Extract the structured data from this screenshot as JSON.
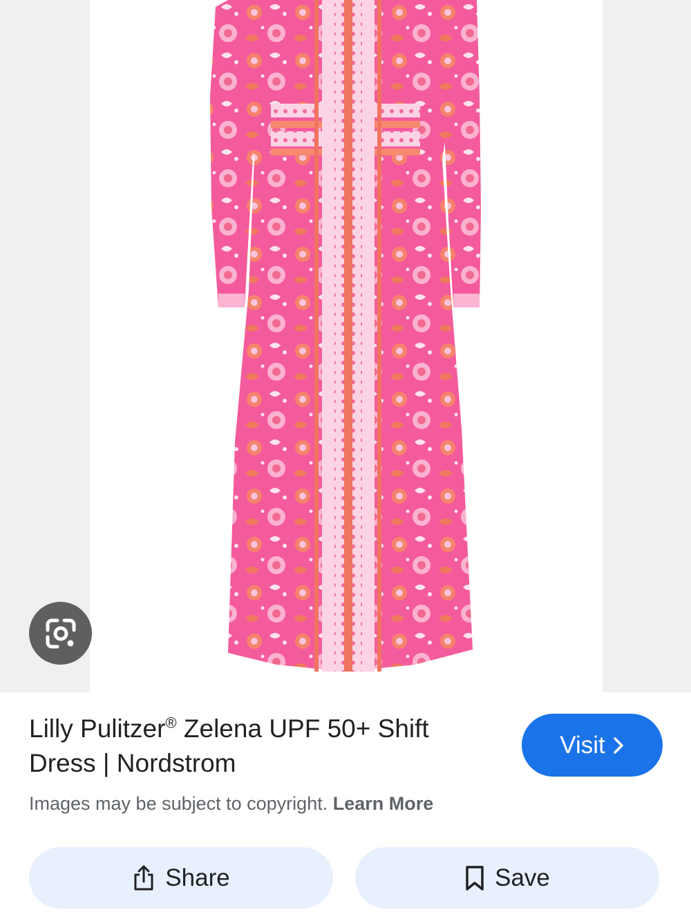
{
  "image": {
    "alt": "Pink printed long-sleeve maxi dress",
    "colors": {
      "background": "#eff0f2",
      "panel": "#ffffff",
      "dress_pink": "#f3609f",
      "dress_light": "#fbb5d2",
      "dress_coral": "#f0745f",
      "dress_white": "#fde3ee"
    }
  },
  "lens": {
    "icon": "google-lens-icon"
  },
  "result": {
    "title_part1": "Lilly Pulitzer",
    "title_reg": "®",
    "title_part2": " Zelena UPF 50+ Shift Dress | Nordstrom",
    "copyright_text": "Images may be subject to copyright. ",
    "learn_more": "Learn More"
  },
  "visit": {
    "label": "Visit",
    "icon": "chevron-right-icon",
    "color": "#1a73e8"
  },
  "actions": {
    "share_label": "Share",
    "share_icon": "share-icon",
    "save_label": "Save",
    "save_icon": "bookmark-icon",
    "button_bg": "#e8f0fe"
  }
}
